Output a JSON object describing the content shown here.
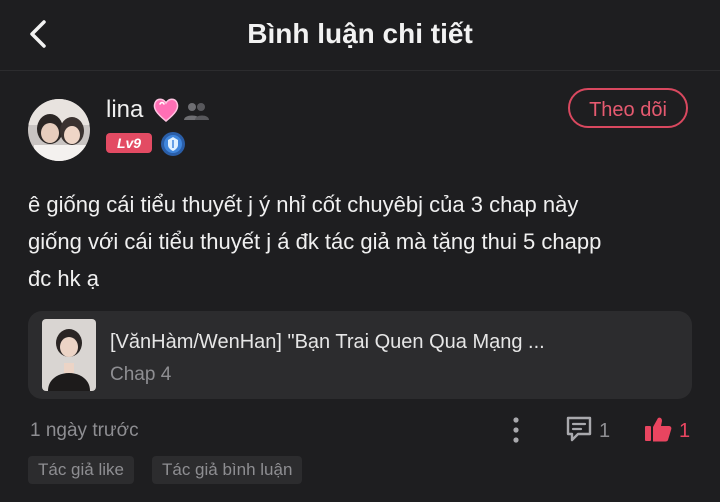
{
  "header": {
    "title": "Bình luận chi tiết",
    "back_icon": "chevron-left-icon"
  },
  "user": {
    "name": "lina",
    "level": "Lv9",
    "follow_label": "Theo dõi",
    "icons": [
      "heart-icon",
      "group-icon",
      "shield-icon"
    ]
  },
  "comment": {
    "lines": [
      "ê giống cái tiểu thuyết j ý nhỉ cốt chuyêbj của 3 chap này",
      "giống với cái tiểu thuyết j á đk tác giả mà tặng thui 5 chapp",
      "đc hk ạ"
    ]
  },
  "chapter": {
    "title": "[VănHàm/WenHan] \"Bạn Trai Quen Qua Mạng ...",
    "subtitle": "Chap 4"
  },
  "footer": {
    "time": "1 ngày trước",
    "reply_count": "1",
    "like_count": "1"
  },
  "tags": [
    "Tác giả like",
    "Tác giả bình luận"
  ],
  "colors": {
    "accent": "#e94560",
    "background": "#1e1e20",
    "card": "#2c2c2e",
    "muted": "#8e8e92"
  }
}
